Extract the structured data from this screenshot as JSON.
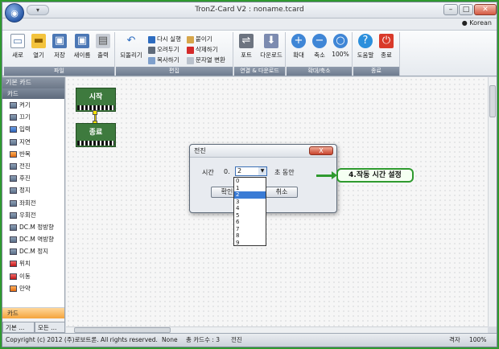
{
  "window": {
    "title": "TronZ-Card V2 : noname.tcard",
    "lang": "Korean"
  },
  "ribbon": {
    "file": {
      "label": "파일",
      "buttons": [
        "새로",
        "열기",
        "저장",
        "새이름",
        "출력"
      ]
    },
    "edit": {
      "label": "편집",
      "undo": "되돌리기",
      "redo": "다시 실행",
      "cut": "오려두기",
      "copy": "복사하기",
      "paste": "붙이기",
      "delete": "삭제하기",
      "convert": "문자열 변환"
    },
    "connect": {
      "label": "연결 & 다운로드",
      "port": "포트",
      "download": "다운로드"
    },
    "zoom": {
      "label": "확대/축소",
      "zoom_in": "확대",
      "zoom_out": "축소",
      "zoom_100": "100%"
    },
    "end": {
      "label": "종료",
      "help": "도움말",
      "exit": "종료"
    }
  },
  "left_panel": {
    "header": "기본 카드",
    "sub": "카드",
    "items": [
      "켜기",
      "끄기",
      "입력",
      "지연",
      "반복",
      "전진",
      "후진",
      "정지",
      "좌회전",
      "우회전",
      "DC.M 정방향",
      "DC.M 역방향",
      "DC.M 정지",
      "위치",
      "이동",
      "만약"
    ],
    "footer_card": "카드",
    "tabs": [
      "기본 ...",
      "모든 ..."
    ]
  },
  "canvas": {
    "blocks": [
      "시작",
      "종료"
    ]
  },
  "dialog": {
    "title": "전진",
    "time_label": "시간",
    "prefix": "0.",
    "selected": "2",
    "suffix": "초 동안",
    "ok": "확인",
    "cancel": "취소",
    "close": "X",
    "options": [
      "0",
      "1",
      "2",
      "3",
      "4",
      "5",
      "6",
      "7",
      "8",
      "9"
    ]
  },
  "callout": "4.작동 시간 설정",
  "status": {
    "copyright": "Copyright (c) 2012 (주)로보트론. All rights reserved.",
    "none": "None",
    "card_count": "총 카드수 : 3",
    "current": "전진",
    "grid": "격자",
    "zoom": "100%"
  }
}
